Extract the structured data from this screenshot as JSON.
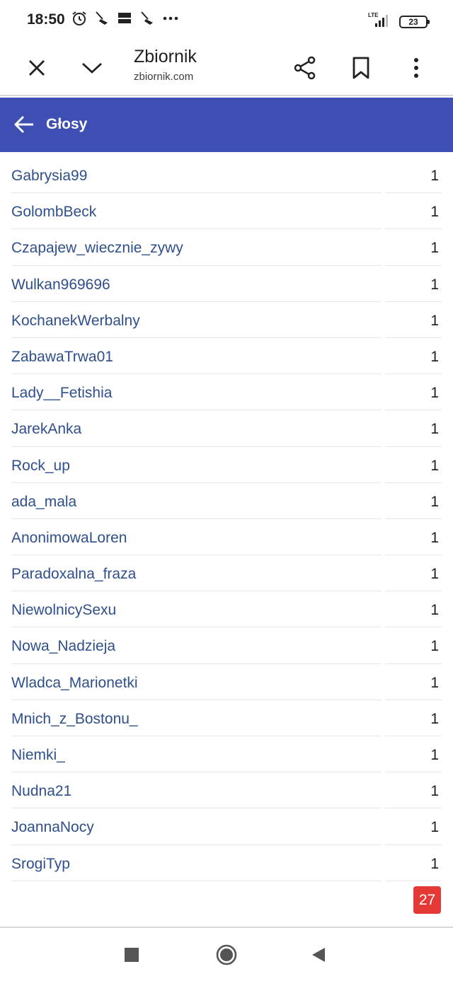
{
  "status_bar": {
    "time": "18:50",
    "battery": "23",
    "network": "LTE",
    "icons": [
      "alarm-icon",
      "broom-icon",
      "temu-icon",
      "broom-icon",
      "more-icon"
    ]
  },
  "browser": {
    "title": "Zbiornik",
    "url": "zbiornik.com",
    "icons": [
      "close-icon",
      "chevron-down-icon",
      "share-icon",
      "bookmark-icon",
      "kebab-menu-icon"
    ]
  },
  "header": {
    "title": "Głosy",
    "color": "#3d4fb3"
  },
  "votes": [
    {
      "name": "Gabrysia99",
      "count": "1"
    },
    {
      "name": "GolombBeck",
      "count": "1"
    },
    {
      "name": "Czapajew_wiecznie_zywy",
      "count": "1"
    },
    {
      "name": "Wulkan969696",
      "count": "1"
    },
    {
      "name": "KochanekWerbalny",
      "count": "1"
    },
    {
      "name": "ZabawaTrwa01",
      "count": "1"
    },
    {
      "name": "Lady__Fetishia",
      "count": "1"
    },
    {
      "name": "JarekAnka",
      "count": "1"
    },
    {
      "name": "Rock_up",
      "count": "1"
    },
    {
      "name": "ada_mala",
      "count": "1"
    },
    {
      "name": "AnonimowaLoren",
      "count": "1"
    },
    {
      "name": "Paradoxalna_fraza",
      "count": "1"
    },
    {
      "name": "NiewolnicySexu",
      "count": "1"
    },
    {
      "name": "Nowa_Nadzieja",
      "count": "1"
    },
    {
      "name": "Wladca_Marionetki",
      "count": "1"
    },
    {
      "name": "Mnich_z_Bostonu_",
      "count": "1"
    },
    {
      "name": "Niemki_",
      "count": "1"
    },
    {
      "name": "Nudna21",
      "count": "1"
    },
    {
      "name": "JoannaNocy",
      "count": "1"
    },
    {
      "name": "SrogiTyp",
      "count": "1"
    }
  ],
  "badge": "27",
  "nav": {
    "icons": [
      "recents-square-icon",
      "home-circle-icon",
      "back-triangle-icon"
    ]
  }
}
